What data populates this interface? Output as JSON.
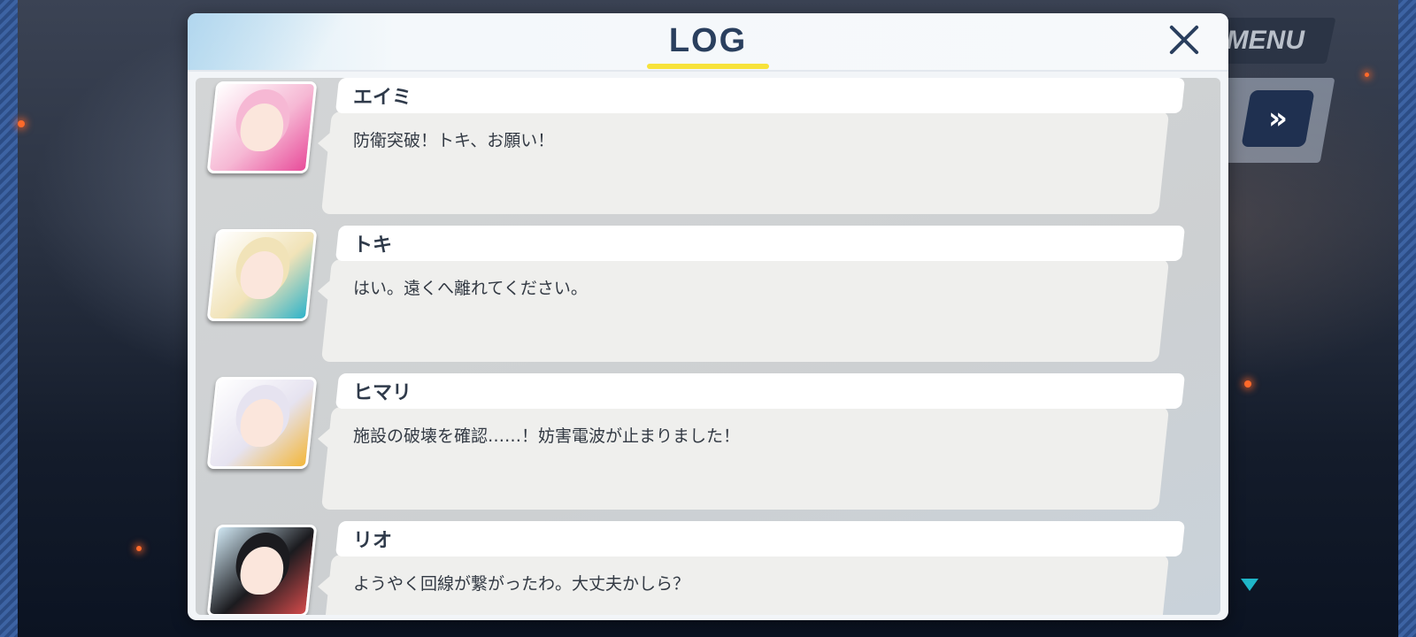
{
  "hud": {
    "menu_label": "MENU",
    "fast_forward_icon": "»"
  },
  "log": {
    "title": "LOG",
    "close_icon": "close-icon",
    "accent_color": "#f7e23a",
    "entries": [
      {
        "speaker": "エイミ",
        "text": "防衛突破！トキ、お願い！",
        "portrait_colors": [
          "#f6b8d4",
          "#e84c9a",
          "#ffffff"
        ]
      },
      {
        "speaker": "トキ",
        "text": "はい。遠くへ離れてください。",
        "portrait_colors": [
          "#f1e3b8",
          "#2fb3c9",
          "#ffffff"
        ]
      },
      {
        "speaker": "ヒマリ",
        "text": "施設の破壊を確認……！妨害電波が止まりました！",
        "portrait_colors": [
          "#e6e3f0",
          "#f3b73b",
          "#ffffff"
        ]
      },
      {
        "speaker": "リオ",
        "text": "ようやく回線が繋がったわ。大丈夫かしら？",
        "portrait_colors": [
          "#1b1b1f",
          "#d24a4a",
          "#cfe6f2"
        ]
      }
    ]
  }
}
